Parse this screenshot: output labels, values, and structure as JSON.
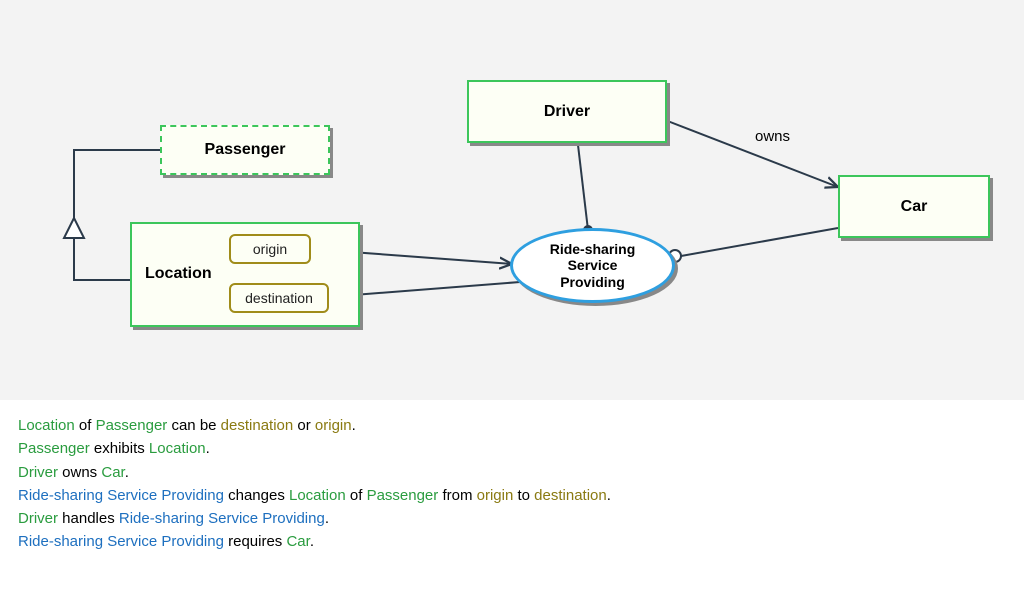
{
  "diagram": {
    "nodes": {
      "passenger": "Passenger",
      "driver": "Driver",
      "car": "Car",
      "location": "Location",
      "origin": "origin",
      "destination": "destination",
      "service": "Ride-sharing\nService\nProviding"
    },
    "edges": {
      "owns": "owns"
    }
  },
  "s1": {
    "a": "Location",
    "b": " of ",
    "c": "Passenger",
    "d": " can be ",
    "e": "destination",
    "f": " or ",
    "g": "origin",
    "h": "."
  },
  "s2": {
    "a": "Passenger",
    "b": " exhibits ",
    "c": "Location",
    "d": "."
  },
  "s3": {
    "a": "Driver",
    "b": " owns ",
    "c": "Car",
    "d": "."
  },
  "s4": {
    "a": "Ride-sharing Service Providing",
    "b": " changes ",
    "c": "Location",
    "d": " of ",
    "e": "Passenger",
    "f": " from ",
    "g": "origin",
    "h": " to ",
    "i": "destination",
    "j": "."
  },
  "s5": {
    "a": "Driver",
    "b": " handles ",
    "c": "Ride-sharing Service Providing",
    "d": "."
  },
  "s6": {
    "a": "Ride-sharing Service Providing",
    "b": " requires ",
    "c": "Car",
    "d": "."
  }
}
